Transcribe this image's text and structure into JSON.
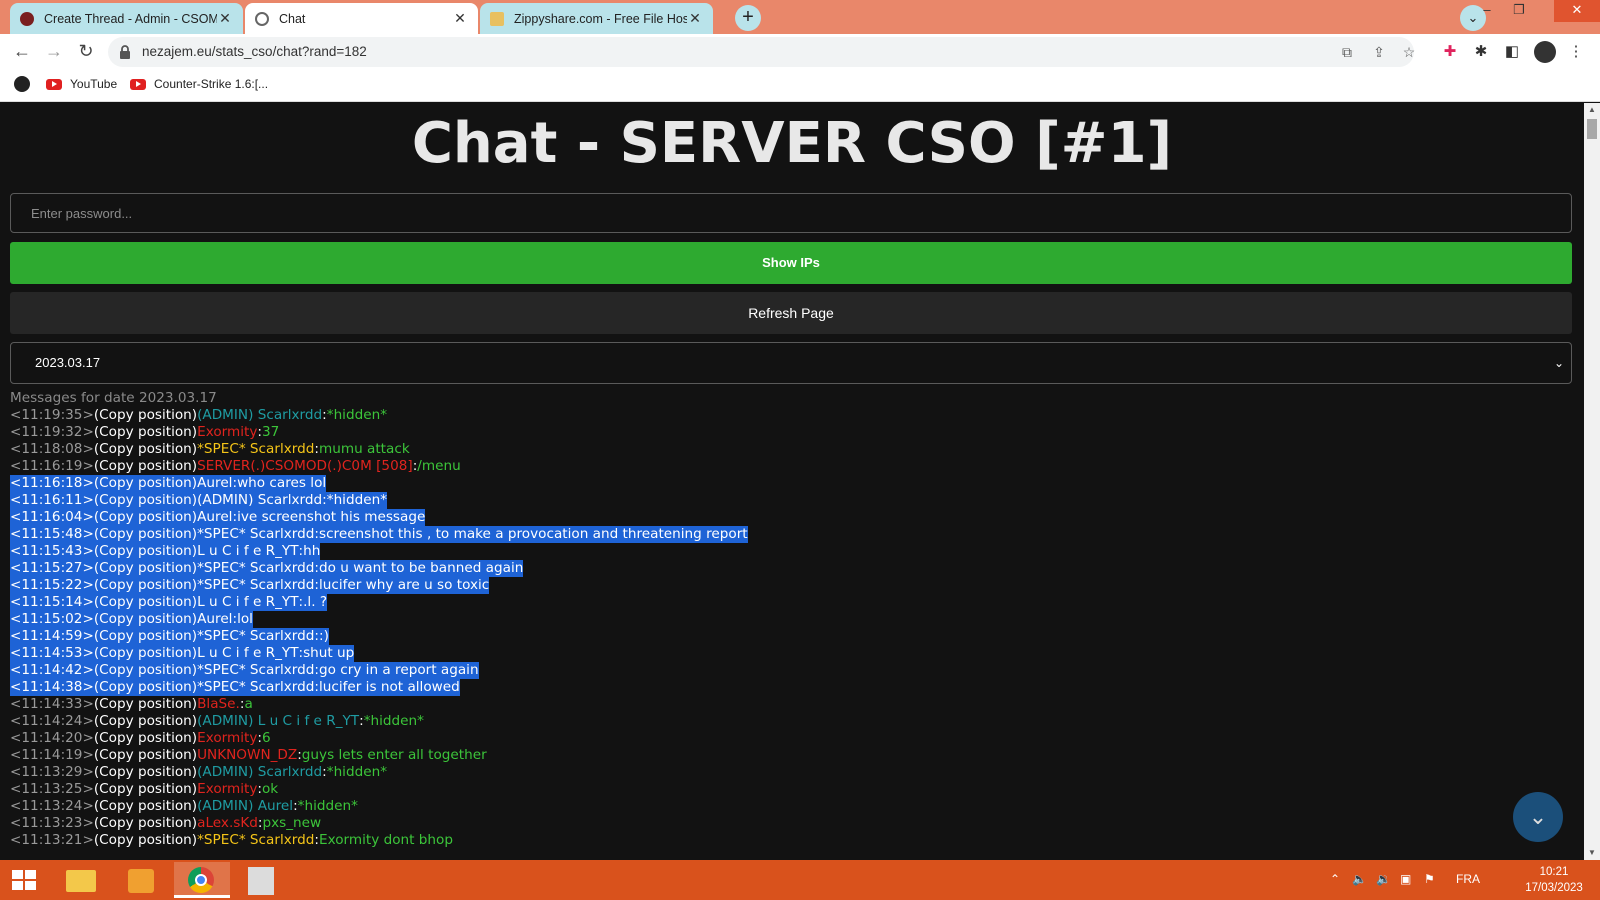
{
  "browser": {
    "tabs": [
      {
        "title": "Create Thread - Admin - CSOMOD",
        "active": false
      },
      {
        "title": "Chat",
        "active": true
      },
      {
        "title": "Zippyshare.com - Free File Hosting",
        "active": false
      }
    ],
    "new_tab_label": "+",
    "url": "nezajem.eu/stats_cso/chat?rand=182",
    "bookmarks": [
      {
        "label": "YouTube"
      },
      {
        "label": "Counter-Strike 1.6:[..."
      }
    ]
  },
  "page": {
    "title": "Chat - SERVER CSO [#1]",
    "password_placeholder": "Enter password...",
    "show_ips_label": "Show IPs",
    "refresh_label": "Refresh Page",
    "selected_date": "2023.03.17",
    "messages_header": "Messages for date 2023.03.17"
  },
  "chat": {
    "copy_label": "(Copy position)",
    "messages": [
      {
        "time": "<11:19:35>",
        "name": "(ADMIN) Scarlxrdd",
        "text": "*hidden*",
        "name_color": "admin",
        "selected": false
      },
      {
        "time": "<11:19:32>",
        "name": "Exormity",
        "text": "37",
        "name_color": "red",
        "selected": false
      },
      {
        "time": "<11:18:08>",
        "name": "*SPEC* Scarlxrdd",
        "text": "mumu attack",
        "name_color": "spec",
        "selected": false
      },
      {
        "time": "<11:16:19>",
        "name": "SERVER(.)CSOMOD(.)C0M [508]",
        "text": "/menu",
        "name_color": "red",
        "selected": false
      },
      {
        "time": "<11:16:18>",
        "name": "Aurel",
        "text": "who cares lol",
        "name_color": "white",
        "selected": true
      },
      {
        "time": "<11:16:11>",
        "name": "(ADMIN) Scarlxrdd",
        "text": "*hidden*",
        "name_color": "admin",
        "selected": true
      },
      {
        "time": "<11:16:04>",
        "name": "Aurel",
        "text": "ive screenshot his message",
        "name_color": "white",
        "selected": true
      },
      {
        "time": "<11:15:48>",
        "name": "*SPEC* Scarlxrdd",
        "text": "screenshot this , to make a provocation and threatening report",
        "name_color": "spec",
        "selected": true
      },
      {
        "time": "<11:15:43>",
        "name": "L u C i f e R_YT",
        "text": "hh",
        "name_color": "white",
        "selected": true
      },
      {
        "time": "<11:15:27>",
        "name": "*SPEC* Scarlxrdd",
        "text": "do u want to be banned again",
        "name_color": "spec",
        "selected": true
      },
      {
        "time": "<11:15:22>",
        "name": "*SPEC* Scarlxrdd",
        "text": "lucifer why are u so toxic",
        "name_color": "spec",
        "selected": true
      },
      {
        "time": "<11:15:14>",
        "name": "L u C i f e R_YT",
        "text": ".l. ?",
        "name_color": "white",
        "selected": true
      },
      {
        "time": "<11:15:02>",
        "name": "Aurel",
        "text": "lol",
        "name_color": "white",
        "selected": true
      },
      {
        "time": "<11:14:59>",
        "name": "*SPEC* Scarlxrdd",
        "text": ":)",
        "name_color": "spec",
        "selected": true
      },
      {
        "time": "<11:14:53>",
        "name": "L u C i f e R_YT",
        "text": "shut up",
        "name_color": "white",
        "selected": true
      },
      {
        "time": "<11:14:42>",
        "name": "*SPEC* Scarlxrdd",
        "text": "go cry in a report again",
        "name_color": "spec",
        "selected": true
      },
      {
        "time": "<11:14:38>",
        "name": "*SPEC* Scarlxrdd",
        "text": "lucifer is not allowed",
        "name_color": "spec",
        "selected": true
      },
      {
        "time": "<11:14:33>",
        "name": "BlaSe.",
        "text": "a",
        "name_color": "red",
        "selected": false
      },
      {
        "time": "<11:14:24>",
        "name": "(ADMIN) L u C i f e R_YT",
        "text": "*hidden*",
        "name_color": "admin",
        "selected": false
      },
      {
        "time": "<11:14:20>",
        "name": "Exormity",
        "text": "6",
        "name_color": "red",
        "selected": false
      },
      {
        "time": "<11:14:19>",
        "name": "UNKNOWN_DZ",
        "text": "guys lets enter all together",
        "name_color": "red",
        "selected": false
      },
      {
        "time": "<11:13:29>",
        "name": "(ADMIN) Scarlxrdd",
        "text": "*hidden*",
        "name_color": "admin",
        "selected": false
      },
      {
        "time": "<11:13:25>",
        "name": "Exormity",
        "text": "ok",
        "name_color": "red",
        "selected": false
      },
      {
        "time": "<11:13:24>",
        "name": "(ADMIN) Aurel",
        "text": "*hidden*",
        "name_color": "admin",
        "selected": false
      },
      {
        "time": "<11:13:23>",
        "name": "aLex.sKd",
        "text": "pxs_new",
        "name_color": "red",
        "selected": false
      },
      {
        "time": "<11:13:21>",
        "name": "*SPEC* Scarlxrdd",
        "text": "Exormity dont bhop",
        "name_color": "spec",
        "selected": false
      }
    ]
  },
  "taskbar": {
    "language": "FRA",
    "time": "10:21",
    "date": "17/03/2023"
  },
  "colors": {
    "accent_green": "#2eaa30",
    "selection_blue": "#1e63d6",
    "admin_teal": "#1f9ca3",
    "spec_yellow": "#f5c518",
    "player_red": "#e0241e",
    "message_green": "#3cc53a",
    "taskbar_orange": "#d9521c",
    "tabbar_salmon": "#e9876a"
  },
  "icons": [
    "back-arrow-icon",
    "forward-arrow-icon",
    "reload-icon",
    "lock-icon",
    "translate-icon",
    "share-icon",
    "star-icon",
    "extension-icon",
    "puzzle-icon",
    "sidepanel-icon",
    "profile-avatar-icon",
    "more-menu-icon",
    "chevron-down-icon",
    "windows-start-icon"
  ]
}
